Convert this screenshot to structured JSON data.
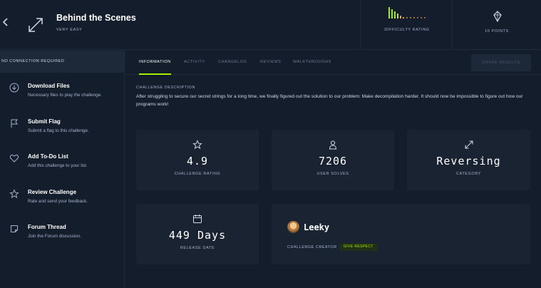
{
  "header": {
    "title": "Behind the Scenes",
    "difficulty_text": "VERY EASY",
    "difficulty_label": "DIFFICULTY RATING",
    "points_label": "10 POINTS",
    "accent": "#9fef00"
  },
  "sidebar": {
    "connection": "NO CONNECTION REQUIRED",
    "items": [
      {
        "label": "Download Files",
        "desc": "Necessary files to play the challenge.",
        "icon": "download-icon"
      },
      {
        "label": "Submit Flag",
        "desc": "Submit a flag to this challenge.",
        "icon": "flag-icon"
      },
      {
        "label": "Add To-Do List",
        "desc": "Add this challenge to your list.",
        "icon": "heart-icon"
      },
      {
        "label": "Review Challenge",
        "desc": "Rate and send your feedback.",
        "icon": "star-icon"
      },
      {
        "label": "Forum Thread",
        "desc": "Join the Forum discussion.",
        "icon": "note-icon"
      }
    ]
  },
  "tabs": [
    "INFORMATION",
    "ACTIVITY",
    "CHANGELOG",
    "REVIEWS",
    "WALKTHROUGHS"
  ],
  "share_label": "SHARE RESULTS",
  "description": {
    "heading": "CHALLENGE DESCRIPTION",
    "text": "After struggling to secure our secret strings for a long time, we finally figured out the solution to our problem: Make decompilation harder. It should now be impossible to figure out how our programs work!"
  },
  "stats": {
    "rating": {
      "value": "4.9",
      "label": "CHALLENGE RATING",
      "icon": "star-icon"
    },
    "solves": {
      "value": "7206",
      "label": "USER SOLVES",
      "icon": "user-icon"
    },
    "category": {
      "value": "Reversing",
      "label": "CATEGORY",
      "icon": "arrows-icon"
    },
    "release": {
      "value": "449 Days",
      "label": "RELEASE DATE",
      "icon": "calendar-icon"
    }
  },
  "creator": {
    "name": "Leeky",
    "label": "CHALLENGE CREATOR",
    "respect": "GIVE RESPECT"
  }
}
